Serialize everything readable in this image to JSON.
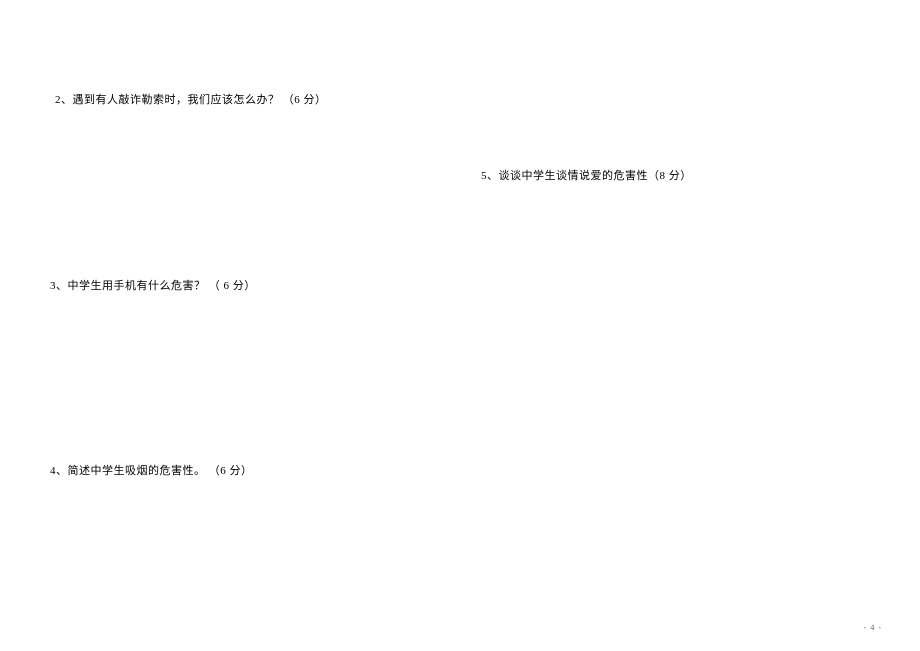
{
  "questions": {
    "q2": "2、遇到有人敲诈勒索时，我们应该怎么办？  （6 分）",
    "q3": "3、中学生用手机有什么危害？ （ 6 分）",
    "q4": "4、简述中学生吸烟的危害性。 （6 分）",
    "q5": "5、谈谈中学生谈情说爱的危害性（8 分）"
  },
  "page_number": "- 4 -"
}
